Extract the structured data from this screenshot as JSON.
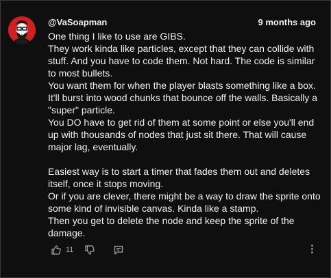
{
  "comment": {
    "author": "@VaSoapman",
    "timestamp": "9 months ago",
    "paragraphs": [
      "One thing I like to use are GIBS.",
      "They work kinda like particles, except that they can collide with stuff. And you have to code them. Not hard. The code is similar to most bullets.",
      "You want them for when the player blasts something like a box. It'll burst into wood chunks that bounce off the walls. Basically a \"super\" particle.",
      "You DO have to get rid of them at some point or else you'll end up with thousands of nodes that just sit there. That will cause major lag, eventually.",
      "",
      "Easiest way is to start a timer that fades them out and deletes itself, once it stops moving.",
      "Or if you are clever, there might be a way to draw the sprite onto some kind of invisible canvas. Kinda like a stamp.",
      "Then you get to delete the node and keep the sprite of the damage."
    ],
    "like_count": "11"
  },
  "icons": {
    "like": "thumbs-up-icon",
    "dislike": "thumbs-down-icon",
    "reply": "reply-icon",
    "more": "more-vertical-icon"
  },
  "colors": {
    "background": "#0f0f0f",
    "text": "#f1f1f1",
    "secondary_text": "#aaaaaa",
    "avatar_bg": "#d21f1f"
  }
}
